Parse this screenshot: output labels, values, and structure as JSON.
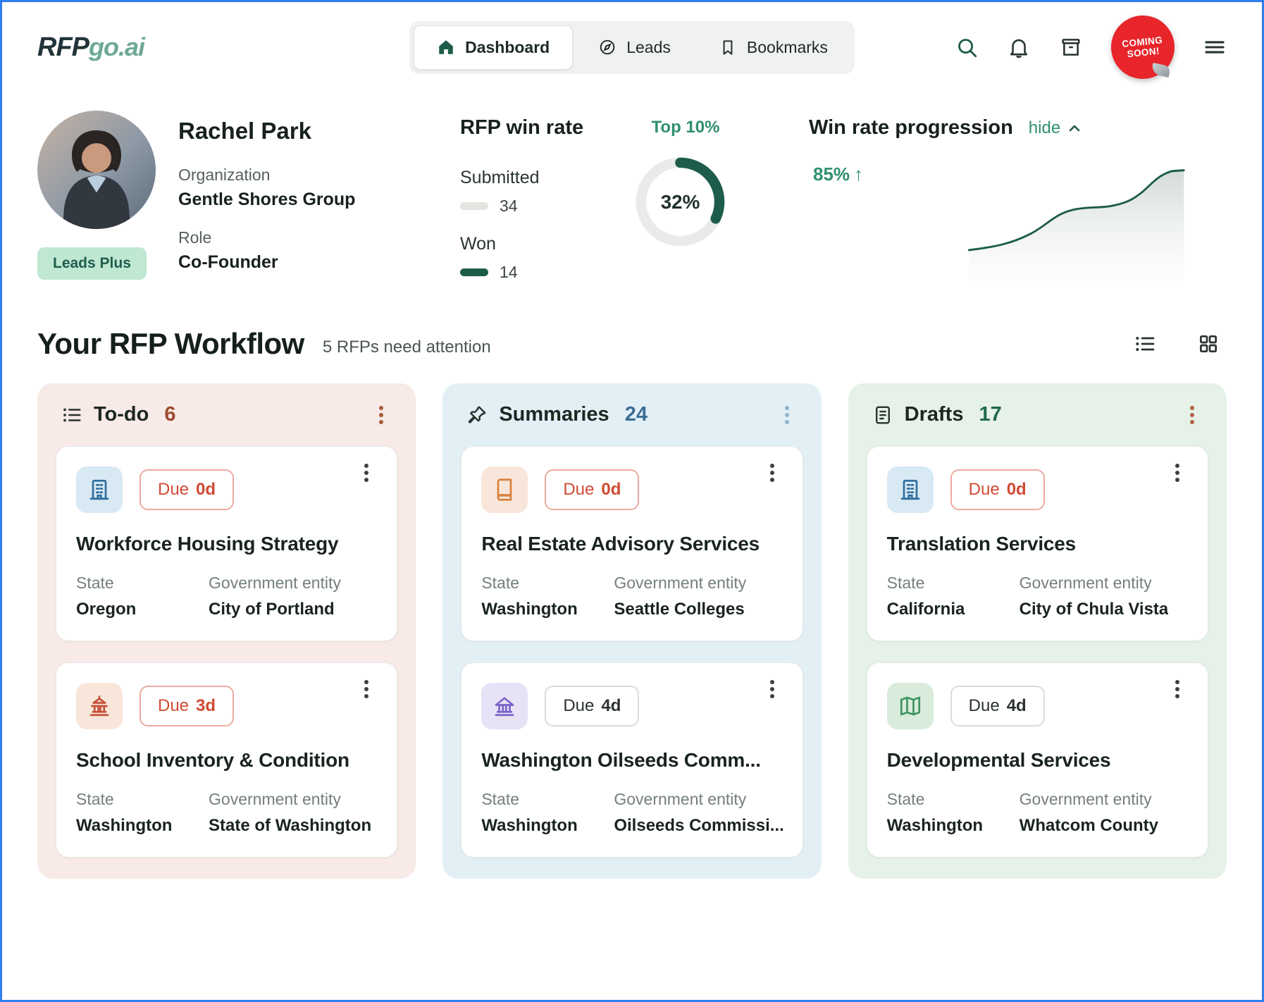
{
  "colors": {
    "frame_blue": "#2f80f0",
    "accent_green": "#1d5c4b",
    "positive_green": "#2f8f6e",
    "urgent_red": "#d04a33",
    "coming_soon_red": "#e8252b",
    "todo_bg": "#f7eae7",
    "summaries_bg": "#e2f0f6",
    "drafts_bg": "#e6f1e7",
    "todo_count": "#9c4a2f",
    "summaries_count": "#3d6f96",
    "drafts_count": "#1d6a4a"
  },
  "brand": {
    "rfp": "RFP",
    "goai": "go.ai"
  },
  "nav": {
    "tabs": [
      {
        "label": "Dashboard"
      },
      {
        "label": "Leads"
      },
      {
        "label": "Bookmarks"
      }
    ],
    "coming_soon_line1": "COMING",
    "coming_soon_line2": "SOON!"
  },
  "profile": {
    "name": "Rachel Park",
    "organization_label": "Organization",
    "organization_value": "Gentle Shores Group",
    "role_label": "Role",
    "role_value": "Co-Founder",
    "plan_badge": "Leads Plus"
  },
  "win_rate": {
    "title": "RFP win rate",
    "tier": "Top 10%",
    "percent": "32%",
    "submitted_label": "Submitted",
    "submitted_value": "34",
    "won_label": "Won",
    "won_value": "14"
  },
  "progression": {
    "title": "Win rate progression",
    "hide": "hide",
    "delta": "85%",
    "arrow": "↑"
  },
  "workflow": {
    "title": "Your RFP Workflow",
    "subtitle": "5 RFPs need attention"
  },
  "labels": {
    "due": "Due",
    "state": "State",
    "entity": "Government entity"
  },
  "columns": [
    {
      "title": "To-do",
      "count": "6",
      "cards": [
        {
          "due_value": "0d",
          "title": "Workforce Housing Strategy",
          "state": "Oregon",
          "entity": "City of Portland"
        },
        {
          "due_value": "3d",
          "title": "School Inventory & Condition",
          "state": "Washington",
          "entity": "State of Washington"
        }
      ]
    },
    {
      "title": "Summaries",
      "count": "24",
      "cards": [
        {
          "due_value": "0d",
          "title": "Real Estate Advisory Services",
          "state": "Washington",
          "entity": "Seattle Colleges"
        },
        {
          "due_value": "4d",
          "title": "Washington Oilseeds Comm...",
          "state": "Washington",
          "entity": "Oilseeds Commissi..."
        }
      ]
    },
    {
      "title": "Drafts",
      "count": "17",
      "cards": [
        {
          "due_value": "0d",
          "title": "Translation Services",
          "state": "California",
          "entity": "City of Chula Vista"
        },
        {
          "due_value": "4d",
          "title": "Developmental Services",
          "state": "Washington",
          "entity": "Whatcom County"
        }
      ]
    }
  ],
  "chart_data": [
    {
      "type": "pie",
      "title": "RFP win rate",
      "slices": [
        {
          "label": "Won",
          "value": 14
        },
        {
          "label": "Submitted",
          "value": 34
        }
      ],
      "center_label": "32%",
      "annotation": "Top 10%"
    },
    {
      "type": "area",
      "title": "Win rate progression",
      "delta": "85%",
      "trend": "up",
      "legend_position": "none",
      "grid": false
    }
  ]
}
